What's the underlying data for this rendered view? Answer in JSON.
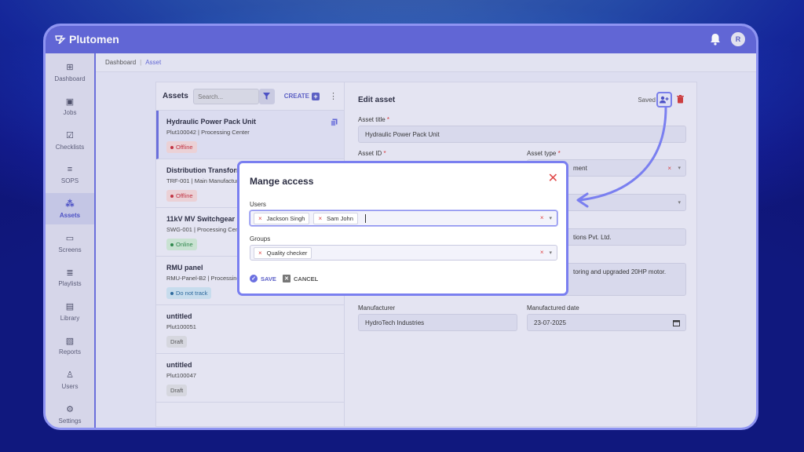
{
  "app": {
    "name": "Plutomen",
    "avatar_initial": "R"
  },
  "sidebar": {
    "items": [
      {
        "label": "Dashboard",
        "icon": "dashboard-icon",
        "glyph": "⊞"
      },
      {
        "label": "Jobs",
        "icon": "briefcase-icon",
        "glyph": "▣"
      },
      {
        "label": "Checklists",
        "icon": "checklist-icon",
        "glyph": "☑"
      },
      {
        "label": "SOPS",
        "icon": "sops-icon",
        "glyph": "≡"
      },
      {
        "label": "Assets",
        "icon": "assets-icon",
        "glyph": "⁂"
      },
      {
        "label": "Screens",
        "icon": "monitor-icon",
        "glyph": "▭"
      },
      {
        "label": "Playlists",
        "icon": "playlist-icon",
        "glyph": "≣"
      },
      {
        "label": "Library",
        "icon": "library-icon",
        "glyph": "▤"
      },
      {
        "label": "Reports",
        "icon": "report-icon",
        "glyph": "▧"
      },
      {
        "label": "Users",
        "icon": "user-icon",
        "glyph": "♙"
      },
      {
        "label": "Settings",
        "icon": "gear-icon",
        "glyph": "⚙"
      }
    ]
  },
  "breadcrumb": {
    "root": "Dashboard",
    "current": "Asset"
  },
  "assets_list": {
    "title": "Assets",
    "search_placeholder": "Search...",
    "create_label": "CREATE",
    "items": [
      {
        "title": "Hydraulic Power Pack Unit",
        "sub": "Plut100042 | Processing Center",
        "status": "Offline"
      },
      {
        "title": "Distribution Transformer",
        "sub": "TRF-001 | Main Manufactur",
        "status": "Offline"
      },
      {
        "title": "11kV MV Switchgear Pa",
        "sub": "SWG-001 | Processing Cent",
        "status": "Online"
      },
      {
        "title": "RMU panel",
        "sub": "RMU-Panel-B2 | Processing",
        "status": "Do not track"
      },
      {
        "title": "untitled",
        "sub": "Plut100051",
        "status": "Draft"
      },
      {
        "title": "untitled",
        "sub": "Plut100047",
        "status": "Draft"
      }
    ]
  },
  "edit_asset": {
    "title": "Edit asset",
    "saved_label": "Saved",
    "asset_title_label": "Asset title",
    "asset_title_value": "Hydraulic Power Pack Unit",
    "asset_id_label": "Asset ID",
    "asset_type_label": "Asset type",
    "asset_type_value": "ment",
    "org_value": "tions Pvt. Ltd.",
    "description_value": "toring and upgraded 20HP motor.",
    "manufacturer_label": "Manufacturer",
    "manufacturer_value": "HydroTech Industries",
    "manufactured_date_label": "Manufactured date",
    "manufactured_date_value": "23-07-2025",
    "required_mark": "*"
  },
  "modal": {
    "title": "Mange access",
    "users_label": "Users",
    "users": [
      "Jackson Singh",
      "Sam John"
    ],
    "groups_label": "Groups",
    "groups": [
      "Quality checker"
    ],
    "save_label": "SAVE",
    "cancel_label": "CANCEL"
  },
  "colors": {
    "accent": "#6065d9",
    "danger": "#e04848",
    "highlight": "#7a7ff0"
  }
}
